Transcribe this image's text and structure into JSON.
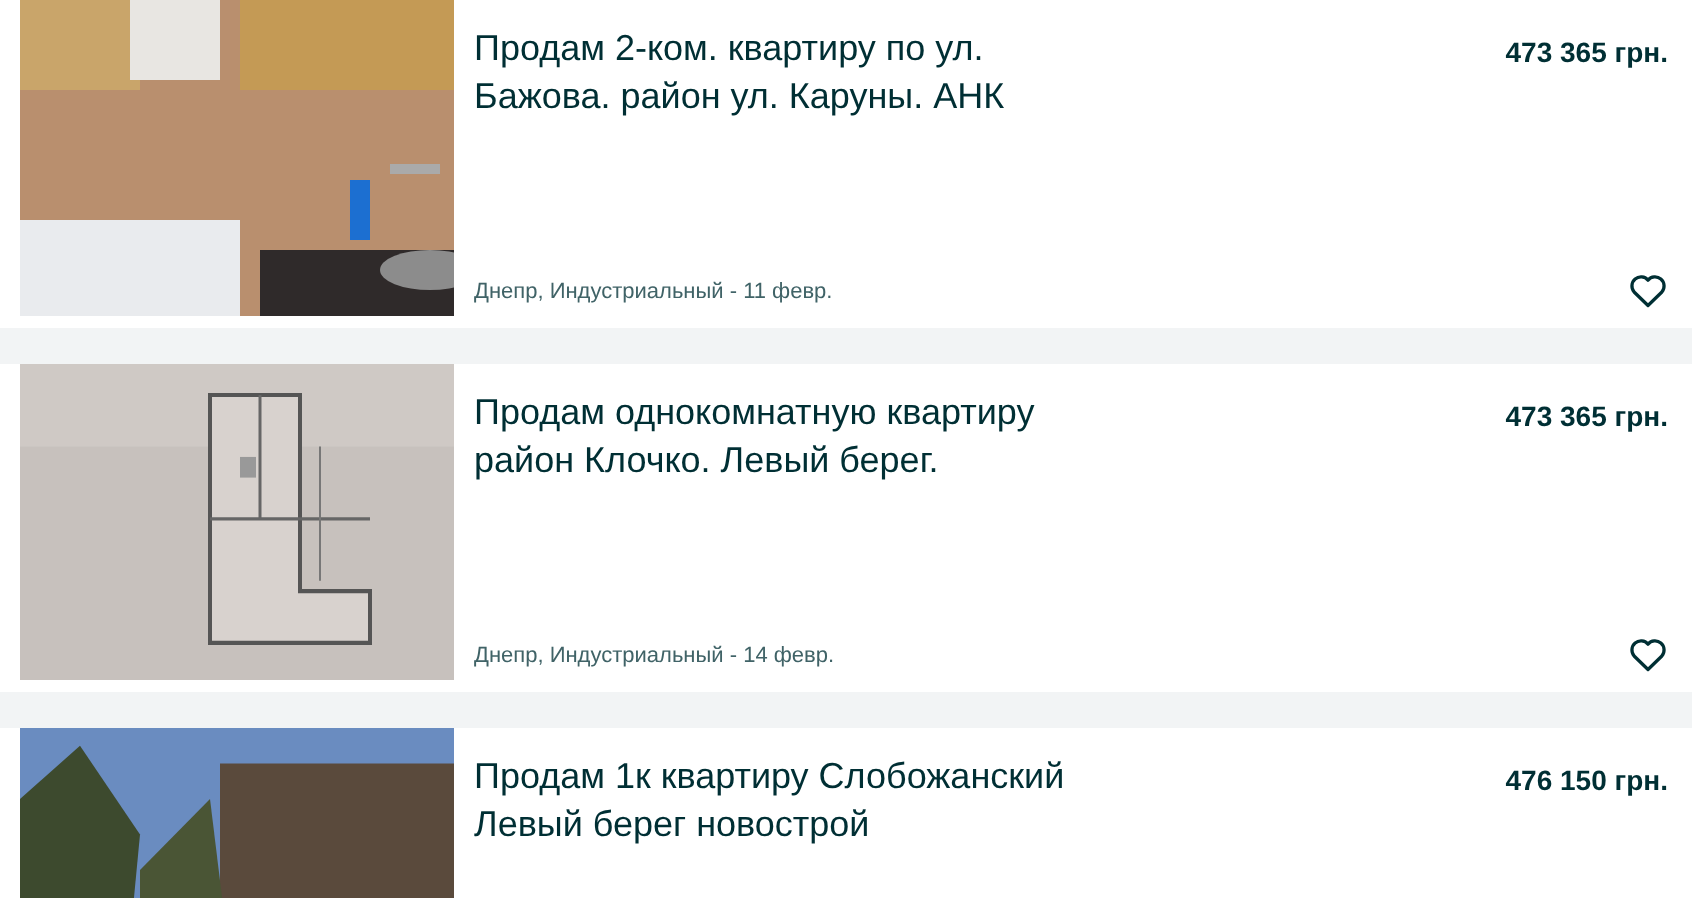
{
  "listings": [
    {
      "title": "Продам 2-ком. квартиру по ул. Бажова. район ул. Каруны. АНК",
      "price": "473 365 грн.",
      "location": "Днепр, Индустриальный - 11 февр.",
      "favorite": false
    },
    {
      "title": "Продам однокомнатную квартиру район Клочко. Левый берег.",
      "price": "473 365 грн.",
      "location": "Днепр, Индустриальный - 14 февр.",
      "favorite": false
    },
    {
      "title": "Продам 1к квартиру Слобожанский Левый берег новострой",
      "price": "476 150 грн."
    }
  ]
}
